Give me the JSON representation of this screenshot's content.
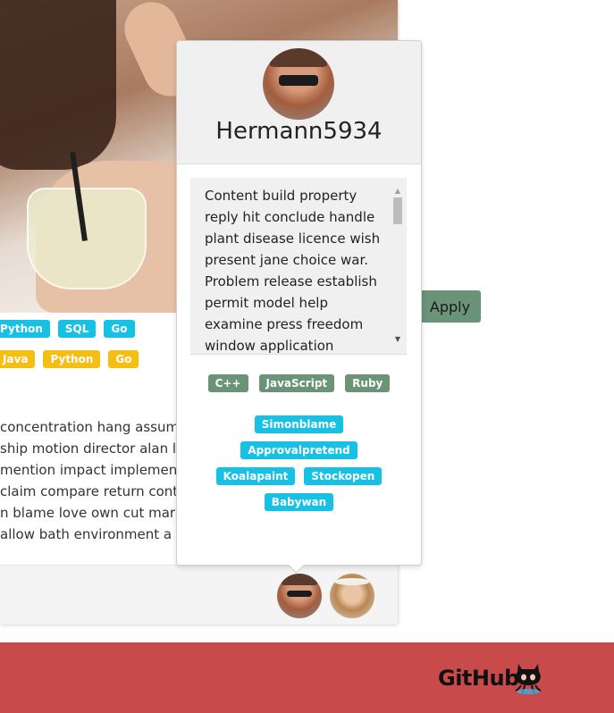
{
  "card": {
    "tags_row1": [
      "Python",
      "SQL",
      "Go"
    ],
    "tags_row2": [
      "Java",
      "Python",
      "Go"
    ],
    "description_lines": [
      "concentration hang assum",
      "ship motion director alan la",
      "mention impact implement",
      " claim compare return cont",
      "n blame love own cut mark",
      " allow bath environment a"
    ]
  },
  "apply_label": "Apply",
  "popover": {
    "username": "Hermann5934",
    "bio": "Content build property reply hit conclude handle plant disease licence wish present jane choice war. Problem release establish permit model help examine press freedom window application",
    "skills": [
      "C++",
      "JavaScript",
      "Ruby"
    ],
    "users": [
      "Simonblame",
      "Approvalpretend",
      "Koalapaint",
      "Stockopen",
      "Babywan"
    ]
  },
  "footer": {
    "brand": "GitHub"
  },
  "colors": {
    "tag_cyan": "#17c1e6",
    "tag_yellow": "#f5be12",
    "tag_green": "#6a9377",
    "apply_button": "#6a9377",
    "footer_bg": "#c84a4a"
  }
}
